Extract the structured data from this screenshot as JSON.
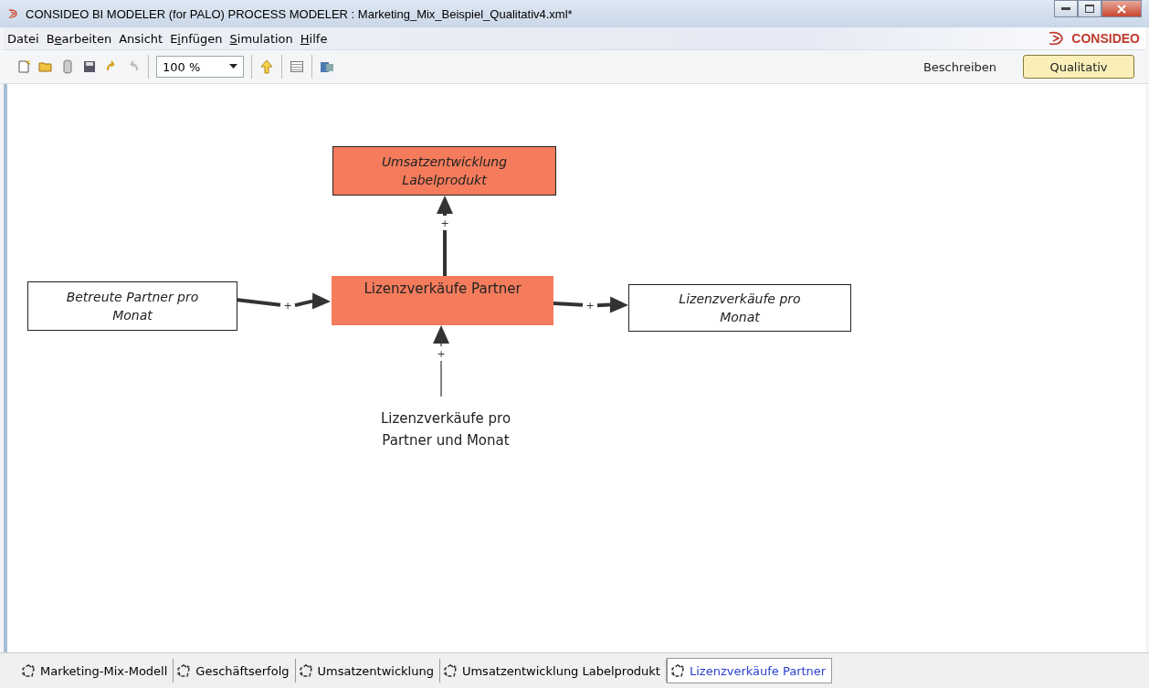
{
  "window": {
    "title": "CONSIDEO BI MODELER (for PALO) PROCESS MODELER : Marketing_Mix_Beispiel_Qualitativ4.xml*"
  },
  "menu": [
    {
      "label": "Datei"
    },
    {
      "before": "B",
      "mnemonic": "e",
      "after": "arbeiten"
    },
    {
      "label": "Ansicht"
    },
    {
      "before": "E",
      "mnemonic": "i",
      "after": "nfügen"
    },
    {
      "mnemonic": "S",
      "after": "imulation"
    },
    {
      "mnemonic": "H",
      "after": "ilfe"
    }
  ],
  "brand": "CONSIDEO",
  "toolbar": {
    "zoom": "100 %"
  },
  "modes": [
    {
      "label": "Beschreiben",
      "selected": false
    },
    {
      "label": "Qualitativ",
      "selected": true
    }
  ],
  "diagram": {
    "nodes": [
      {
        "label": "Umsatzentwicklung Labelprodukt",
        "kind": "target"
      },
      {
        "label": "Lizenzverkäufe Partner",
        "kind": "focus"
      },
      {
        "label": "Betreute Partner pro Monat",
        "kind": "variable"
      },
      {
        "label": "Lizenzverkäufe pro Monat",
        "kind": "variable"
      },
      {
        "label": "Lizenzverkäufe pro Partner und Monat",
        "kind": "constant"
      }
    ],
    "edges": [
      {
        "sign": "+",
        "kind": "strong"
      },
      {
        "sign": "+",
        "kind": "strong"
      },
      {
        "sign": "+",
        "kind": "strong"
      },
      {
        "sign": "+",
        "kind": "thin"
      }
    ]
  },
  "tabs": [
    {
      "label": "Marketing-Mix-Modell",
      "selected": false
    },
    {
      "label": "Geschäftserfolg",
      "selected": false
    },
    {
      "label": "Umsatzentwicklung",
      "selected": false
    },
    {
      "label": "Umsatzentwicklung Labelprodukt",
      "selected": false
    },
    {
      "label": "Lizenzverkäufe Partner",
      "selected": true
    }
  ]
}
